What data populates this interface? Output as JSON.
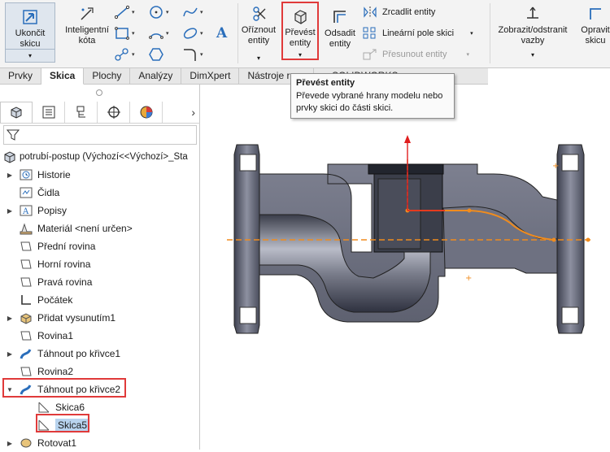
{
  "ribbon": {
    "exit_sketch": "Ukončit\nskicu",
    "smart_dimension": "Inteligentní\nkóta",
    "trim_entities": "Oříznout\nentity",
    "convert_entities": "Převést\nentity",
    "offset_entities": "Odsadit\nentity",
    "mirror_entities": "Zrcadlit entity",
    "linear_pattern": "Lineární pole skici",
    "move_entities": "Přesunout entity",
    "display_relations": "Zobrazit/odstranit\nvazby",
    "repair_sketch": "Opravit\nskicu"
  },
  "tabs": [
    {
      "label": "Prvky",
      "active": false
    },
    {
      "label": "Skica",
      "active": true
    },
    {
      "label": "Plochy",
      "active": false
    },
    {
      "label": "Analýzy",
      "active": false
    },
    {
      "label": "DimXpert",
      "active": false
    },
    {
      "label": "Nástroje re…",
      "active": false
    },
    {
      "label": "…SOLIDWORKS",
      "active": false
    }
  ],
  "tooltip": {
    "title": "Převést entity",
    "body": "Převede vybrané hrany modelu nebo prvky skici do části skici."
  },
  "feature_tree": {
    "root": "potrubí-postup  (Výchozí<<Výchozí>_Sta",
    "items": [
      {
        "label": "Historie",
        "icon": "history-icon",
        "expandable": true
      },
      {
        "label": "Čidla",
        "icon": "sensors-icon",
        "expandable": false
      },
      {
        "label": "Popisy",
        "icon": "annotations-icon",
        "expandable": true
      },
      {
        "label": "Materiál <není určen>",
        "icon": "material-icon",
        "expandable": false
      },
      {
        "label": "Přední rovina",
        "icon": "plane-icon",
        "expandable": false
      },
      {
        "label": "Horní rovina",
        "icon": "plane-icon",
        "expandable": false
      },
      {
        "label": "Pravá rovina",
        "icon": "plane-icon",
        "expandable": false
      },
      {
        "label": "Počátek",
        "icon": "origin-icon",
        "expandable": false
      },
      {
        "label": "Přidat vysunutím1",
        "icon": "extrude-icon",
        "expandable": true
      },
      {
        "label": "Rovina1",
        "icon": "plane-icon",
        "expandable": false
      },
      {
        "label": "Táhnout po křivce1",
        "icon": "sweep-icon",
        "expandable": true
      },
      {
        "label": "Rovina2",
        "icon": "plane-icon",
        "expandable": false
      },
      {
        "label": "Táhnout po křivce2",
        "icon": "sweep-icon",
        "expandable": true,
        "expanded": true
      },
      {
        "label": "Skica6",
        "icon": "sketch-icon",
        "expandable": false,
        "child": true
      },
      {
        "label": "Skica5",
        "icon": "sketch-icon",
        "expandable": false,
        "child": true,
        "selected": true
      },
      {
        "label": "Rotovat1",
        "icon": "revolve-icon",
        "expandable": true
      }
    ]
  },
  "colors": {
    "highlight": "#e03a3a",
    "sketch_orange": "#f08c1e",
    "axis_red": "#e01e1e",
    "model_gray": "#6b6e7a"
  }
}
